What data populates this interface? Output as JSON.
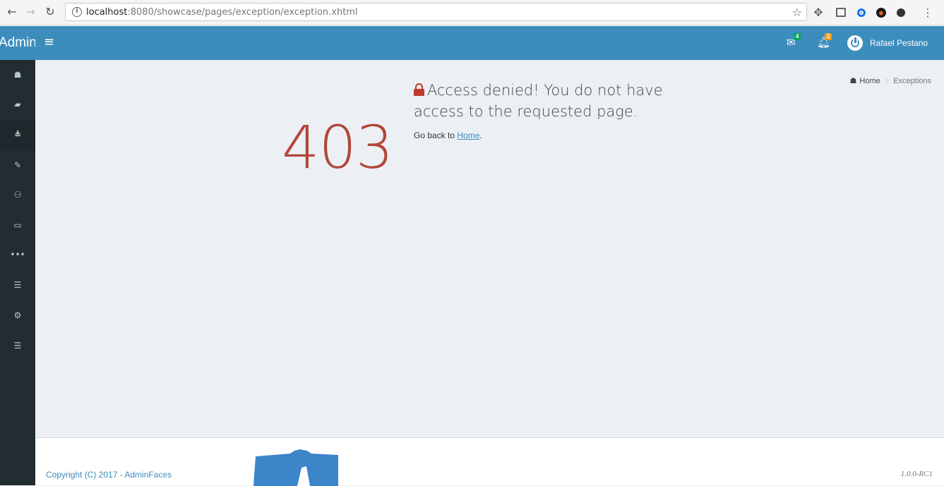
{
  "browser": {
    "url_host": "localhost",
    "url_path": ":8080/showcase/pages/exception/exception.xhtml"
  },
  "header": {
    "logo": "Admin",
    "messages_count": "4",
    "notifications_count": "2",
    "user_name": "Rafael Pestano",
    "color": "#3c8dbc"
  },
  "sidebar": {
    "items": [
      {
        "icon": "home-icon"
      },
      {
        "icon": "book-icon"
      },
      {
        "icon": "stack-icon"
      },
      {
        "icon": "edit-icon"
      },
      {
        "icon": "users-icon"
      },
      {
        "icon": "laptop-icon"
      },
      {
        "icon": "ellipsis-icon"
      },
      {
        "icon": "list-icon"
      },
      {
        "icon": "cogs-icon"
      },
      {
        "icon": "list-icon"
      }
    ]
  },
  "breadcrumb": {
    "home": "Home",
    "current": "Exceptions"
  },
  "error": {
    "code": "403",
    "title": "Access denied! You do not have access to the requested page.",
    "go_back_prefix": "Go back to",
    "go_back_link": "Home",
    "go_back_suffix": ".",
    "code_color": "#b04838"
  },
  "footer": {
    "copyright": "Copyright (C) 2017 - AdminFaces",
    "version": "1.0.0-RC1"
  }
}
